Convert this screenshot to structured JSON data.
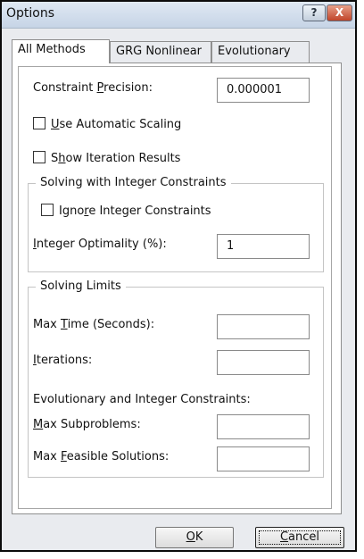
{
  "window": {
    "title": "Options",
    "help_glyph": "?",
    "close_glyph": "X"
  },
  "tabs": [
    {
      "label": "All Methods",
      "selected": true
    },
    {
      "label": "GRG Nonlinear",
      "selected": false
    },
    {
      "label": "Evolutionary",
      "selected": false
    }
  ],
  "constraint_precision": {
    "pre": "Constraint ",
    "key": "P",
    "post": "recision:",
    "value": "0.000001"
  },
  "use_automatic_scaling": {
    "pre": "",
    "key": "U",
    "post": "se Automatic Scaling",
    "checked": false
  },
  "show_iteration_results": {
    "pre": "S",
    "key": "h",
    "post": "ow Iteration Results",
    "checked": false
  },
  "integer_group": {
    "title": "Solving with Integer Constraints",
    "ignore": {
      "pre": "Igno",
      "key": "r",
      "post": "e Integer Constraints",
      "checked": false
    },
    "optimality": {
      "pre": "",
      "key": "I",
      "post": "nteger Optimality (%):",
      "value": "1"
    }
  },
  "limits_group": {
    "title": "Solving Limits",
    "max_time": {
      "pre": "Max ",
      "key": "T",
      "post": "ime (Seconds):",
      "value": ""
    },
    "iterations": {
      "pre": "",
      "key": "I",
      "post": "terations:",
      "value": ""
    },
    "evo_heading": "Evolutionary and Integer Constraints:",
    "max_subproblems": {
      "pre": "",
      "key": "M",
      "post": "ax Subproblems:",
      "value": ""
    },
    "max_feasible": {
      "pre": "Max ",
      "key": "F",
      "post": "easible Solutions:",
      "value": ""
    }
  },
  "buttons": {
    "ok": {
      "pre": "",
      "key": "O",
      "post": "K"
    },
    "cancel": {
      "pre": "",
      "key": "C",
      "post": "ancel"
    }
  },
  "colors": {
    "titlebar": "#c6d4e6",
    "close_button": "#c0452a",
    "dialog_background": "#e9ebef"
  }
}
